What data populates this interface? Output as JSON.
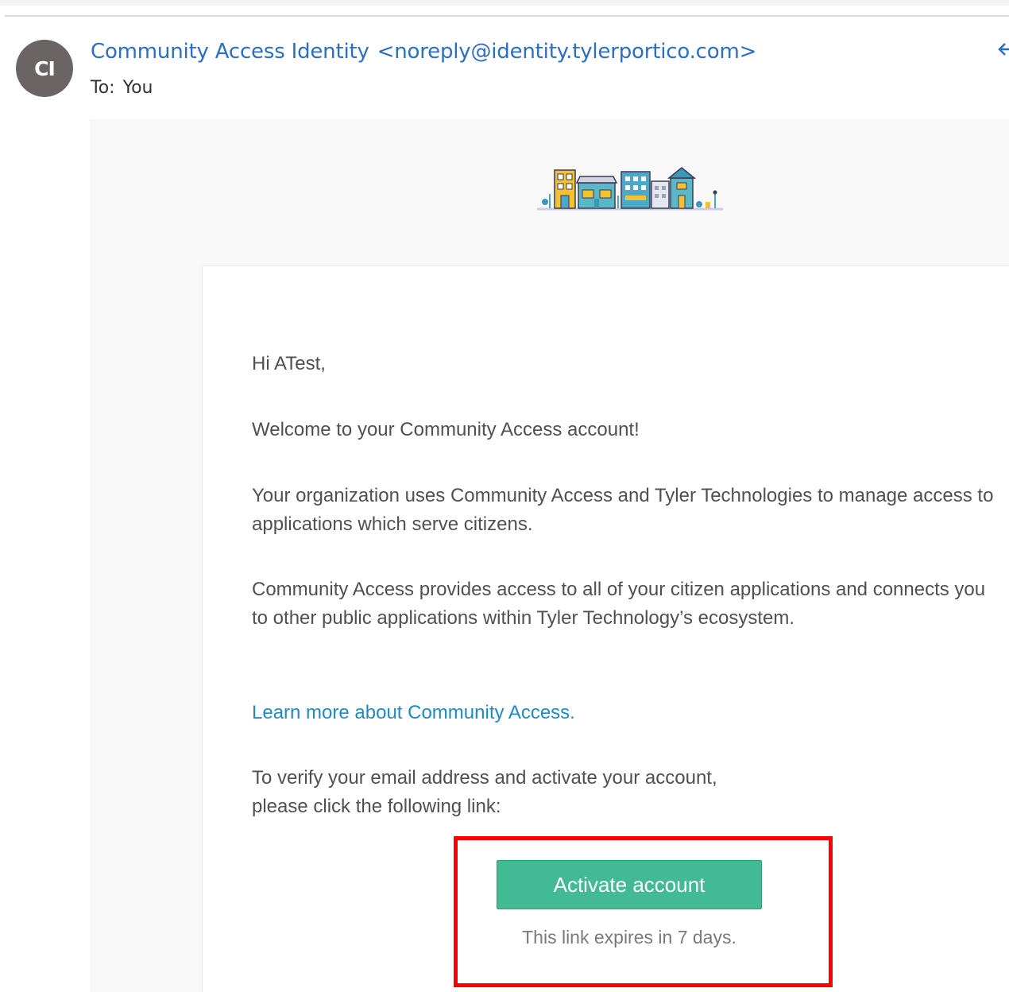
{
  "header": {
    "avatar_initials": "CI",
    "sender_name": "Community Access Identity",
    "sender_email": "<noreply@identity.tylerportico.com>",
    "to_label": "To:",
    "to_value": "You",
    "reply_icon": "reply-arrow-icon"
  },
  "banner": {
    "icon": "town-buildings-illustration",
    "colors": [
      "#f2c230",
      "#4aa8c8",
      "#5bb8c9",
      "#3f97b8",
      "#cfd4e0"
    ]
  },
  "body": {
    "greeting": "Hi ATest,",
    "welcome": "Welcome to your Community Access account!",
    "org_text": "Your organization uses Community Access and Tyler Technologies to manage access to applications which serve citizens.",
    "provides_text": "Community Access provides access to all of your citizen applications and connects you to other public applications within Tyler Technology’s ecosystem.",
    "learn_more_link": "Learn more about Community Access.",
    "verify_text_line1": "To verify your email address and activate your account,",
    "verify_text_line2": "please click the following link:",
    "activate_button": "Activate account",
    "expires_text": "This link expires in 7 days."
  },
  "colors": {
    "link": "#1f8ac4",
    "sender": "#2b6ec3",
    "button": "#42ba94",
    "highlight": "#ff0000",
    "avatar": "#6b6464"
  }
}
